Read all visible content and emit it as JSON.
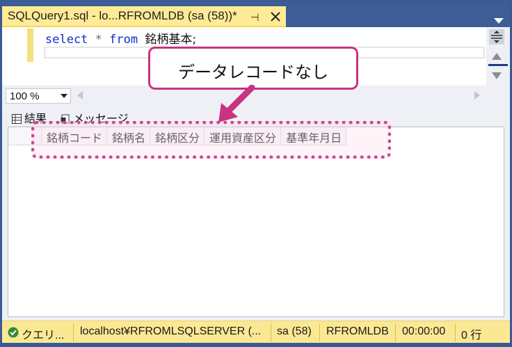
{
  "tab": {
    "title": "SQLQuery1.sql - lo...RFROMLDB (sa (58))*",
    "pin_icon": "pin-icon",
    "close_icon": "close-icon"
  },
  "editor": {
    "code": {
      "keyword_select": "select",
      "operator_star": "*",
      "keyword_from": "from",
      "table_name": "銘柄基本;"
    }
  },
  "zoom": {
    "value": "100 %"
  },
  "results": {
    "tabs": [
      {
        "label": "結果",
        "icon": "grid-icon"
      },
      {
        "label": "メッセージ",
        "icon": "message-icon"
      }
    ],
    "columns": [
      "銘柄コード",
      "銘柄名",
      "銘柄区分",
      "運用資産区分",
      "基準年月日"
    ],
    "rows": []
  },
  "annotation": {
    "callout_text": "データレコードなし",
    "accent_color": "#c8327f"
  },
  "status": {
    "query": "クエリ...",
    "server": "localhost¥RFROMLSQLSERVER (...",
    "user": "sa (58)",
    "database": "RFROMLDB",
    "elapsed": "00:00:00",
    "rows": "0 行"
  },
  "colors": {
    "window_frame": "#3b5a93",
    "tab_active": "#ffeb95",
    "status_bar": "#fbe893",
    "keyword": "#0b2fd0"
  }
}
